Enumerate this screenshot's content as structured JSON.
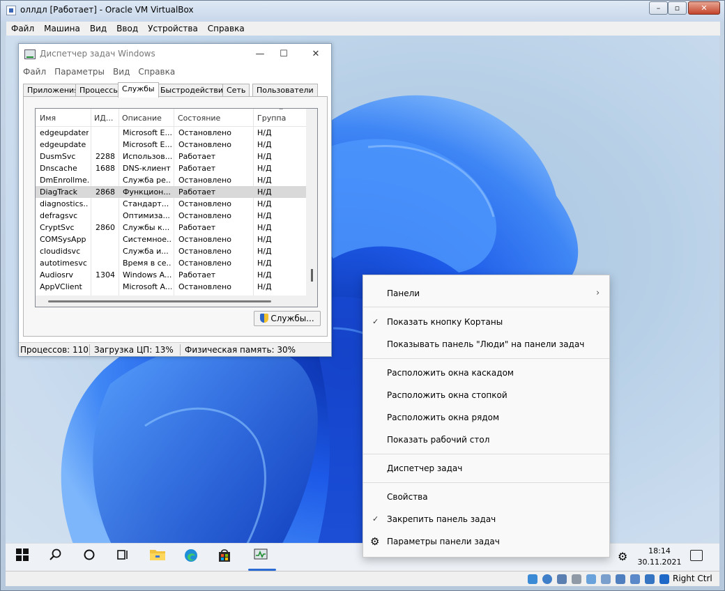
{
  "host": {
    "title": "оллдл [Работает] - Oracle VM VirtualBox",
    "menu": [
      "Файл",
      "Машина",
      "Вид",
      "Ввод",
      "Устройства",
      "Справка"
    ],
    "status_right": "Right Ctrl"
  },
  "taskmgr": {
    "title": "Диспетчер задач Windows",
    "menu": [
      "Файл",
      "Параметры",
      "Вид",
      "Справка"
    ],
    "tabs": [
      "Приложения",
      "Процессы",
      "Службы",
      "Быстродействие",
      "Сеть",
      "Пользователи"
    ],
    "active_tab": "Службы",
    "columns": [
      "Имя",
      "ИД...",
      "Описание",
      "Состояние",
      "Группа"
    ],
    "rows": [
      {
        "name": "edgeupdatem",
        "pid": "",
        "desc": "Microsoft E...",
        "state": "Остановлено",
        "group": "Н/Д"
      },
      {
        "name": "edgeupdate",
        "pid": "",
        "desc": "Microsoft E...",
        "state": "Остановлено",
        "group": "Н/Д"
      },
      {
        "name": "DusmSvc",
        "pid": "2288",
        "desc": "Использов...",
        "state": "Работает",
        "group": "Н/Д"
      },
      {
        "name": "Dnscache",
        "pid": "1688",
        "desc": "DNS-клиент",
        "state": "Работает",
        "group": "Н/Д"
      },
      {
        "name": "DmEnrollme...",
        "pid": "",
        "desc": "Служба ре...",
        "state": "Остановлено",
        "group": "Н/Д"
      },
      {
        "name": "DiagTrack",
        "pid": "2868",
        "desc": "Функцион...",
        "state": "Работает",
        "group": "Н/Д",
        "selected": true
      },
      {
        "name": "diagnostics...",
        "pid": "",
        "desc": "Стандарт...",
        "state": "Остановлено",
        "group": "Н/Д"
      },
      {
        "name": "defragsvc",
        "pid": "",
        "desc": "Оптимиза...",
        "state": "Остановлено",
        "group": "Н/Д"
      },
      {
        "name": "CryptSvc",
        "pid": "2860",
        "desc": "Службы к...",
        "state": "Работает",
        "group": "Н/Д"
      },
      {
        "name": "COMSysApp",
        "pid": "",
        "desc": "Системное...",
        "state": "Остановлено",
        "group": "Н/Д"
      },
      {
        "name": "cloudidsvc",
        "pid": "",
        "desc": "Служба и...",
        "state": "Остановлено",
        "group": "Н/Д"
      },
      {
        "name": "autotimesvc",
        "pid": "",
        "desc": "Время в се...",
        "state": "Остановлено",
        "group": "Н/Д"
      },
      {
        "name": "Audiosrv",
        "pid": "1304",
        "desc": "Windows A...",
        "state": "Работает",
        "group": "Н/Д"
      },
      {
        "name": "AppVClient",
        "pid": "",
        "desc": "Microsoft A...",
        "state": "Остановлено",
        "group": "Н/Д"
      }
    ],
    "services_button": "Службы...",
    "status": {
      "processes": "Процессов: 110",
      "cpu": "Загрузка ЦП: 13%",
      "memory": "Физическая память: 30%"
    }
  },
  "context_menu": {
    "items": [
      {
        "label": "Панели",
        "submenu": true
      },
      {
        "label": "Показать кнопку Кортаны",
        "checked": true
      },
      {
        "label": "Показывать панель \"Люди\" на панели задач"
      },
      {
        "label": "Расположить окна каскадом"
      },
      {
        "label": "Расположить окна стопкой"
      },
      {
        "label": "Расположить окна рядом"
      },
      {
        "label": "Показать рабочий стол"
      },
      {
        "label": "Диспетчер задач"
      },
      {
        "label": "Свойства"
      },
      {
        "label": "Закрепить панель задач",
        "checked": true
      },
      {
        "label": "Параметры панели задач",
        "icon": "gear-icon"
      }
    ]
  },
  "guest_taskbar": {
    "time": "18:14",
    "date": "30.11.2021"
  },
  "colors": {
    "accent": "#2b6cd4",
    "wallpaper_blue": "#1a4fd8",
    "selection": "#d9d9d9"
  }
}
